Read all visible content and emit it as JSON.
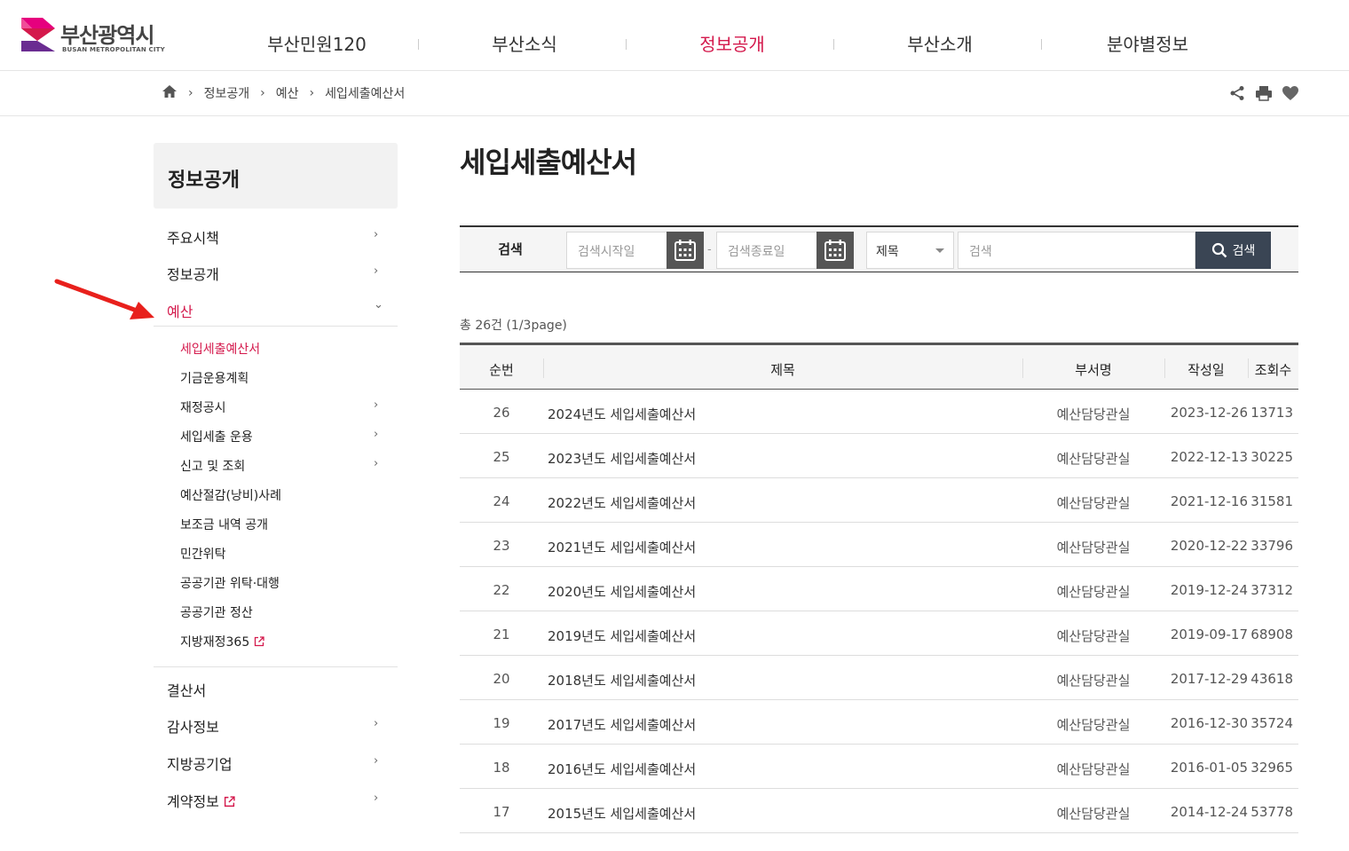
{
  "header": {
    "logo_text": "부산광역시",
    "logo_sub": "BUSAN METROPOLITAN CITY",
    "nav": [
      "부산민원120",
      "부산소식",
      "정보공개",
      "부산소개",
      "분야별정보"
    ],
    "active_nav": "정보공개"
  },
  "breadcrumb": [
    "정보공개",
    "예산",
    "세입세출예산서"
  ],
  "tools": [
    "share-icon",
    "print-icon",
    "heart-icon"
  ],
  "sidebar": {
    "title": "정보공개",
    "items": [
      {
        "label": "주요시책",
        "arrow": "›"
      },
      {
        "label": "정보공개",
        "arrow": "›"
      },
      {
        "label": "예산",
        "arrow": "⌄"
      }
    ],
    "sub_items": [
      {
        "label": "세입세출예산서",
        "arrow": ""
      },
      {
        "label": "기금운용계획",
        "arrow": ""
      },
      {
        "label": "재정공시",
        "arrow": "›"
      },
      {
        "label": "세입세출 운용",
        "arrow": "›"
      },
      {
        "label": "신고 및 조회",
        "arrow": "›"
      },
      {
        "label": "예산절감(낭비)사례",
        "arrow": ""
      },
      {
        "label": "보조금 내역 공개",
        "arrow": ""
      },
      {
        "label": "민간위탁",
        "arrow": ""
      },
      {
        "label": "공공기관 위탁·대행",
        "arrow": ""
      },
      {
        "label": "공공기관 정산",
        "arrow": ""
      },
      {
        "label": "지방재정365",
        "arrow": ""
      }
    ],
    "bottom_items": [
      {
        "label": "결산서",
        "arrow": ""
      },
      {
        "label": "감사정보",
        "arrow": "›"
      },
      {
        "label": "지방공기업",
        "arrow": "›"
      },
      {
        "label": "계약정보",
        "arrow": "›"
      }
    ]
  },
  "main": {
    "title": "세입세출예산서",
    "search": {
      "label": "검색",
      "start_placeholder": "검색시작일",
      "end_placeholder": "검색종료일",
      "dash": "-",
      "select_value": "제목",
      "keyword_placeholder": "검색",
      "button_label": "검색"
    },
    "total": "총 26건 (1/3page)",
    "columns": [
      "순번",
      "제목",
      "부서명",
      "작성일",
      "조회수"
    ],
    "rows": [
      [
        "26",
        "2024년도 세입세출예산서",
        "예산담당관실",
        "2023-12-26",
        "13713"
      ],
      [
        "25",
        "2023년도 세입세출예산서",
        "예산담당관실",
        "2022-12-13",
        "30225"
      ],
      [
        "24",
        "2022년도 세입세출예산서",
        "예산담당관실",
        "2021-12-16",
        "31581"
      ],
      [
        "23",
        "2021년도 세입세출예산서",
        "예산담당관실",
        "2020-12-22",
        "33796"
      ],
      [
        "22",
        "2020년도 세입세출예산서",
        "예산담당관실",
        "2019-12-24",
        "37312"
      ],
      [
        "21",
        "2019년도 세입세출예산서",
        "예산담당관실",
        "2019-09-17",
        "68908"
      ],
      [
        "20",
        "2018년도 세입세출예산서",
        "예산담당관실",
        "2017-12-29",
        "43618"
      ],
      [
        "19",
        "2017년도 세입세출예산서",
        "예산담당관실",
        "2016-12-30",
        "35724"
      ],
      [
        "18",
        "2016년도 세입세출예산서",
        "예산담당관실",
        "2016-01-05",
        "32965"
      ],
      [
        "17",
        "2015년도 세입세출예산서",
        "예산담당관실",
        "2014-12-24",
        "53778"
      ]
    ]
  },
  "colors": {
    "accent": "#d4194c",
    "search_button": "#3a4554",
    "arrow": "#e8201c"
  }
}
